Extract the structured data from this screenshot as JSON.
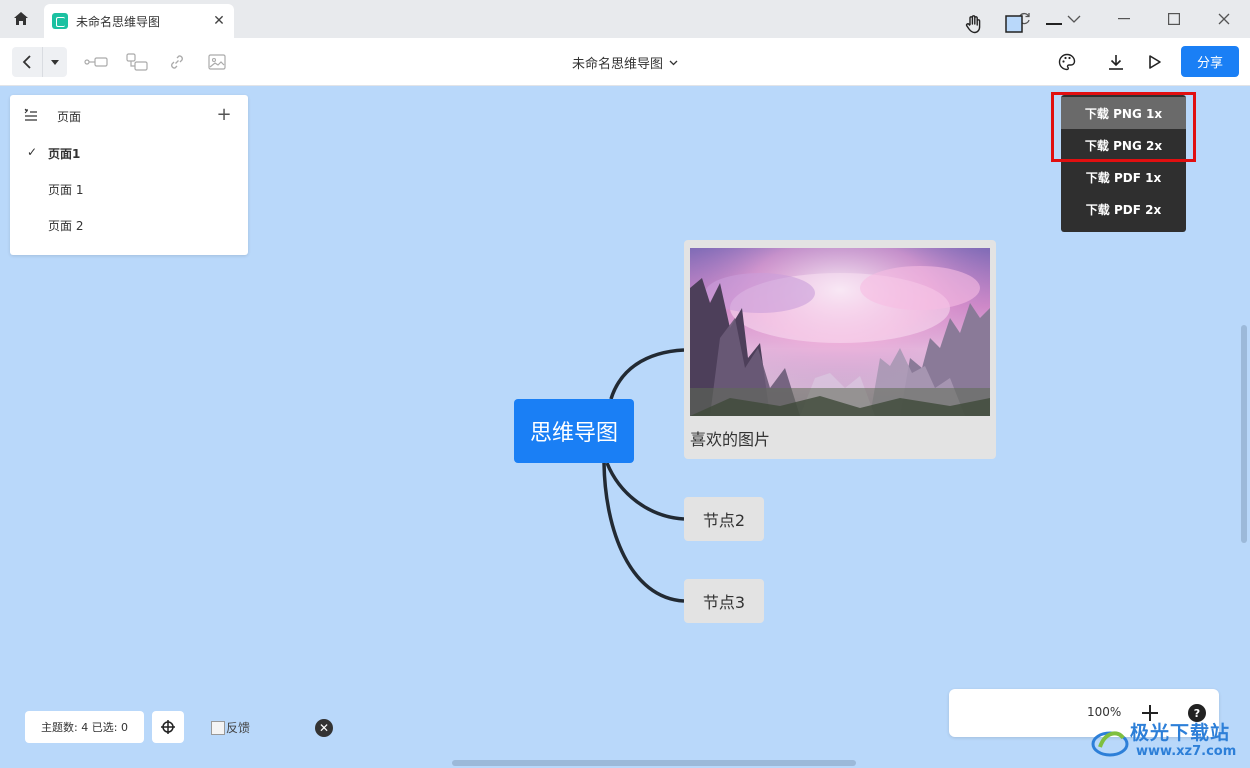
{
  "window": {
    "tab_title": "未命名思维导图",
    "tab_close": "✕",
    "controls": [
      "refresh",
      "collapse",
      "minimize",
      "maximize",
      "close"
    ]
  },
  "toolbar": {
    "doc_title": "未命名思维导图",
    "share_label": "分享",
    "icons": [
      "back-icon",
      "dropdown-icon",
      "sibling-node-icon",
      "child-node-icon",
      "link-icon",
      "image-icon",
      "palette-icon",
      "download-icon",
      "play-icon"
    ]
  },
  "pages_panel": {
    "title": "页面",
    "add": "+",
    "items": [
      {
        "label": "页面1",
        "active": true
      },
      {
        "label": "页面 1",
        "active": false
      },
      {
        "label": "页面 2",
        "active": false
      }
    ]
  },
  "mindmap": {
    "root": "思维导图",
    "children": [
      {
        "type": "image",
        "caption": "喜欢的图片"
      },
      {
        "type": "text",
        "label": "节点2"
      },
      {
        "type": "text",
        "label": "节点3"
      }
    ]
  },
  "download_menu": {
    "items": [
      "下载 PNG 1x",
      "下载 PNG 2x",
      "下载 PDF 1x",
      "下载 PDF 2x"
    ],
    "hovered_index": 0,
    "highlight_color": "#e10f10"
  },
  "status": {
    "text": "主题数: 4 已选: 0",
    "feedback_alt": "反馈"
  },
  "zoom": {
    "percent": "100%",
    "help": "?"
  },
  "watermark": {
    "line1": "极光下载站",
    "line2": "www.xz7.com"
  },
  "colors": {
    "accent": "#1a7ff5",
    "canvas": "#b9d8fa",
    "menu_bg": "#2f2f2f"
  }
}
